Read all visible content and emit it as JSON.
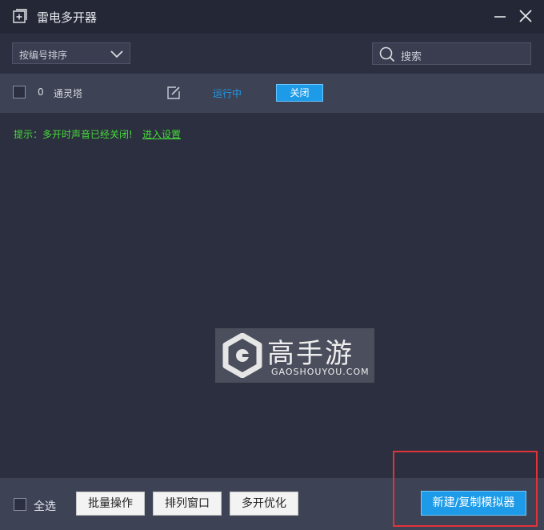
{
  "window": {
    "title": "雷电多开器",
    "icons": {
      "app": "add-window-icon",
      "minimize": "minimize-icon",
      "close": "close-icon"
    }
  },
  "toolbar": {
    "sort_selected": "按编号排序",
    "search_placeholder": "搜索"
  },
  "instances": [
    {
      "index": "0",
      "name": "通灵塔",
      "status": "运行中",
      "action_label": "关闭"
    }
  ],
  "hint": {
    "text": "提示：多开时声音已经关闭!",
    "link": "进入设置"
  },
  "watermark": {
    "cn": "高手游",
    "en": "GAOSHOUYOU.COM"
  },
  "footer": {
    "select_all": "全选",
    "batch_ops": "批量操作",
    "arrange_windows": "排列窗口",
    "multi_optimize": "多开优化",
    "new_copy": "新建/复制模拟器"
  },
  "colors": {
    "background": "#2c2f3f",
    "titlebar": "#242735",
    "row": "#3e4255",
    "accent": "#1e9be8",
    "hint_green": "#46d93a",
    "highlight_red": "#e0343a"
  }
}
